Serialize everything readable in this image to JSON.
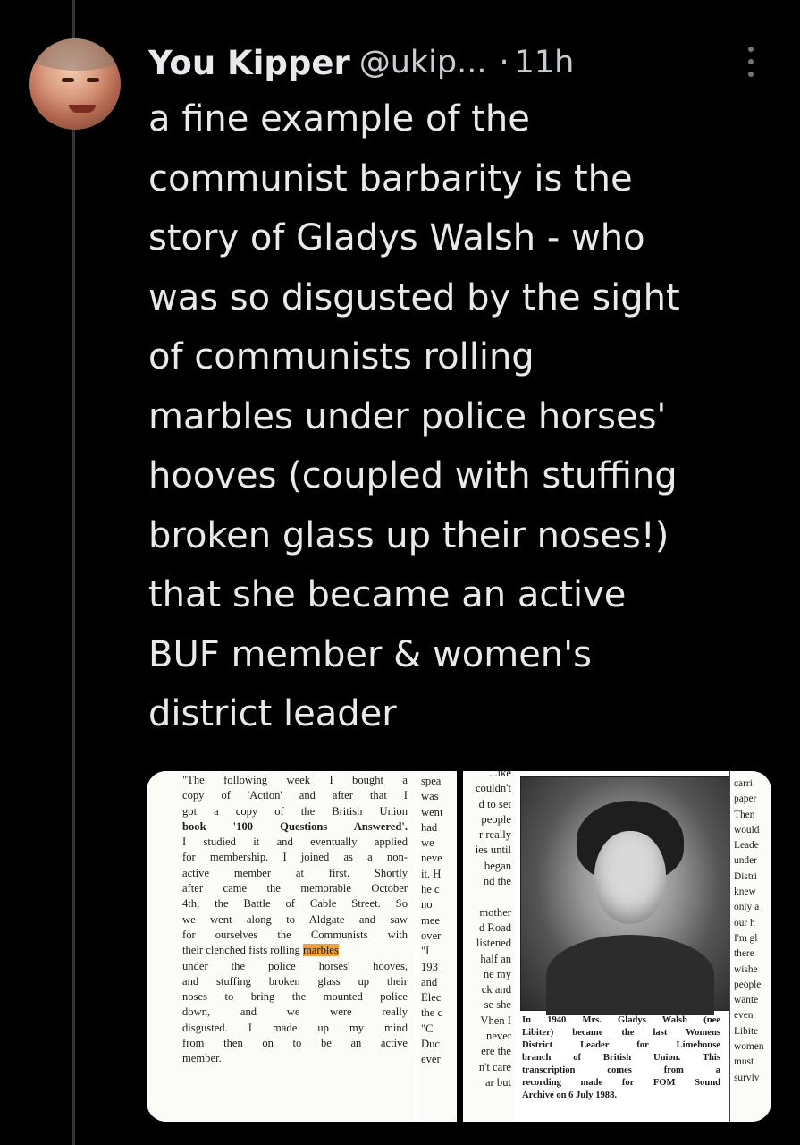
{
  "tweet": {
    "display_name": "You Kipper",
    "handle": "@ukip...",
    "separator": "·",
    "time": "11h",
    "text_lines": [
      "a fine example of the",
      "communist barbarity is the",
      "story of Gladys Walsh - who",
      "was so disgusted by the sight",
      "of communists rolling",
      "marbles under police horses'",
      "hooves (coupled with stuffing",
      "broken glass up their noses!)",
      "that she became an active",
      "BUF member & women's",
      "district leader"
    ]
  },
  "icons": {
    "more": "more-options-icon",
    "avatar": "avatar"
  },
  "colors": {
    "background": "#000000",
    "text": "#e7e9ea",
    "secondary": "#71767b",
    "highlight": "#f1a03a"
  },
  "clipping": {
    "column_left": [
      "\"The following week I bought a",
      "copy of 'Action' and after that I",
      "got a copy of the British Union",
      "book '100 Questions Answered'.",
      "I studied it and eventually applied",
      "for membership. I joined as a non-",
      "active member at first. Shortly",
      "after came the memorable October",
      "4th, the Battle of Cable Street. So",
      "we went along to Aldgate and saw",
      "for ourselves the Communists with",
      "their clenched fists rolling",
      "under the police horses' hooves,",
      "and stuffing broken glass up their",
      "noses to bring the mounted police",
      "down, and we were really",
      "disgusted. I made up my mind",
      "from then on to be an active",
      "member."
    ],
    "highlight_word": "marbles",
    "column_mid_a": [
      "spea",
      "was",
      "went",
      "had",
      "we",
      "neve",
      "it. H",
      "he c",
      "no",
      "mee",
      "over",
      "\"I",
      "193",
      "and",
      "Elec",
      "the c",
      "\"C",
      "Duc",
      "ever"
    ],
    "column_mid_b": [
      "...ike",
      "couldn't",
      "d to set",
      "people",
      "r really",
      "ies until",
      "began",
      "nd the",
      "",
      "mother",
      "d Road",
      "listened",
      "half an",
      "ne my",
      "ck and",
      "se she",
      "Vhen I",
      "never",
      "ere the",
      "n't care",
      "ar but"
    ],
    "column_right": [
      "carri",
      "paper",
      "Then",
      "would",
      "Leade",
      "under",
      "Distri",
      "knew",
      "only a",
      "our h",
      "I'm gl",
      "there",
      "wishe",
      "people",
      "wante",
      "even",
      "Libite",
      "women",
      "must",
      "surviv"
    ],
    "photo_caption": [
      "In 1940 Mrs. Gladys Walsh (nee",
      "Libiter) became the last Womens",
      "District Leader for Limehouse",
      "branch of British Union. This",
      "transcription comes from a",
      "recording made for FOM Sound",
      "Archive on 6 July 1988."
    ]
  }
}
